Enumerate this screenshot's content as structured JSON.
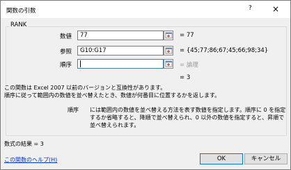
{
  "dialog": {
    "title": "関数の引数",
    "help_glyph": "?",
    "close_glyph": "×"
  },
  "function_name": "RANK",
  "args": [
    {
      "label": "数値",
      "value": "77",
      "result": "=  77",
      "result_gray": false
    },
    {
      "label": "参照",
      "value": "G10:G17",
      "result": "=  {45;77;86;67;45;66;98;34}",
      "result_gray": false
    },
    {
      "label": "順序",
      "value": "",
      "result": "=  論理",
      "result_gray": true
    }
  ],
  "overall_result": "=  3",
  "description_line1": "この関数は Excel 2007 以前のバージョンと互換性があります。",
  "description_line2": "順序に従って範囲内の数値を並べ替えたとき、数値が何番目に位置するかを返します。",
  "arg_desc_label": "順序",
  "arg_desc_text": "には範囲内の数値を並べ替える方法を表す数値を指定します。順序に 0 を指定するか省略すると、降順で並べ替えられ、0 以外の数値を指定すると、昇順で並べ替えられます。",
  "formula_result": "数式の結果 =  3",
  "help_link": "この関数のヘルプ(H)",
  "buttons": {
    "ok": "OK",
    "cancel": "キャンセル"
  }
}
